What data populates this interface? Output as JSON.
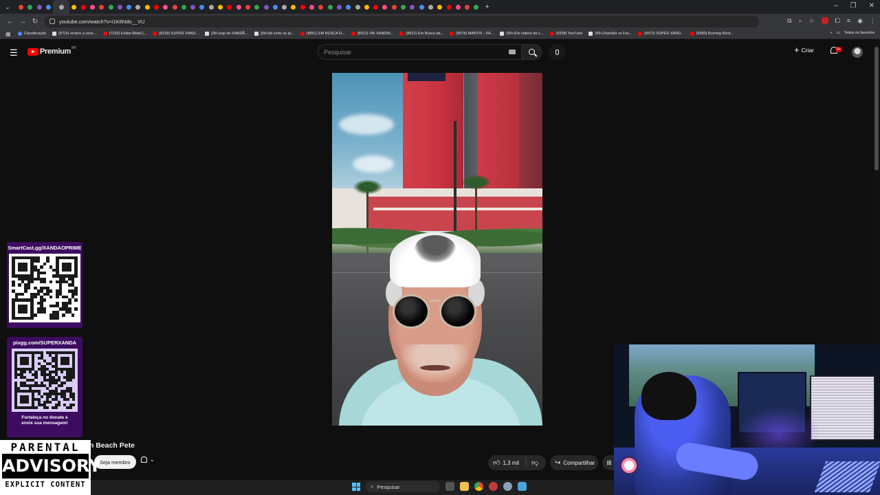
{
  "browser": {
    "url": "youtube.com/watch?v=i1K6Ndo__VU",
    "tabs_count": 50,
    "bookmarks": [
      {
        "label": "Classificação",
        "type": "blue"
      },
      {
        "label": "(97)Te ensino a venc...",
        "type": "tik"
      },
      {
        "label": "(7292) Evilas Metal |...",
        "type": "yt"
      },
      {
        "label": "(8159) SUPER XAND...",
        "type": "yt"
      },
      {
        "label": "(99+)rap do XANDÃ...",
        "type": "tik"
      },
      {
        "label": "(99+)tá cedo ou já...",
        "type": "tik"
      },
      {
        "label": "(8851) EM BUSCA D...",
        "type": "yt"
      },
      {
        "label": "(8912) VAI XANDIN...",
        "type": "yt"
      },
      {
        "label": "(8912) Em Busca da...",
        "type": "yt"
      },
      {
        "label": "(9078) MANTIS - XA...",
        "type": "yt"
      },
      {
        "label": "(99+)Os vídeos de c...",
        "type": "tik"
      },
      {
        "label": "(9338) YouTube",
        "type": "yt"
      },
      {
        "label": "(99+)Xandão vs Fra...",
        "type": "tik"
      },
      {
        "label": "(9572) SUPER XAND...",
        "type": "yt"
      },
      {
        "label": "(9580) Burning Bord...",
        "type": "yt"
      }
    ],
    "all_bookmarks_label": "Todos os favoritos"
  },
  "youtube": {
    "logo_text": "Premium",
    "logo_region": "BR",
    "search_placeholder": "Pesquisar",
    "create_label": "Criar",
    "notifications_badge": "9+",
    "video_title": "n Beach Pete",
    "member_button": "Seja membro",
    "likes": "1,3 mil",
    "share_label": "Compartilhar"
  },
  "overlays": {
    "qr_top_label": "SmartCast.gg/XANDAOPRIME",
    "qr_bottom_label": "pixgg.com/SUPERXANDA",
    "qr_bottom_note_1": "Fortaleça no donate e",
    "qr_bottom_note_2": "envie sua mensagem!",
    "advisory_top": "PARENTAL",
    "advisory_mid": "ADVISORY",
    "advisory_bot": "EXPLICIT CONTENT"
  },
  "taskbar": {
    "search_label": "Pesquisar"
  },
  "colors": {
    "youtube_red": "#ff0000",
    "qr_panel": "#3d0b60",
    "background": "#0f0f0f"
  }
}
